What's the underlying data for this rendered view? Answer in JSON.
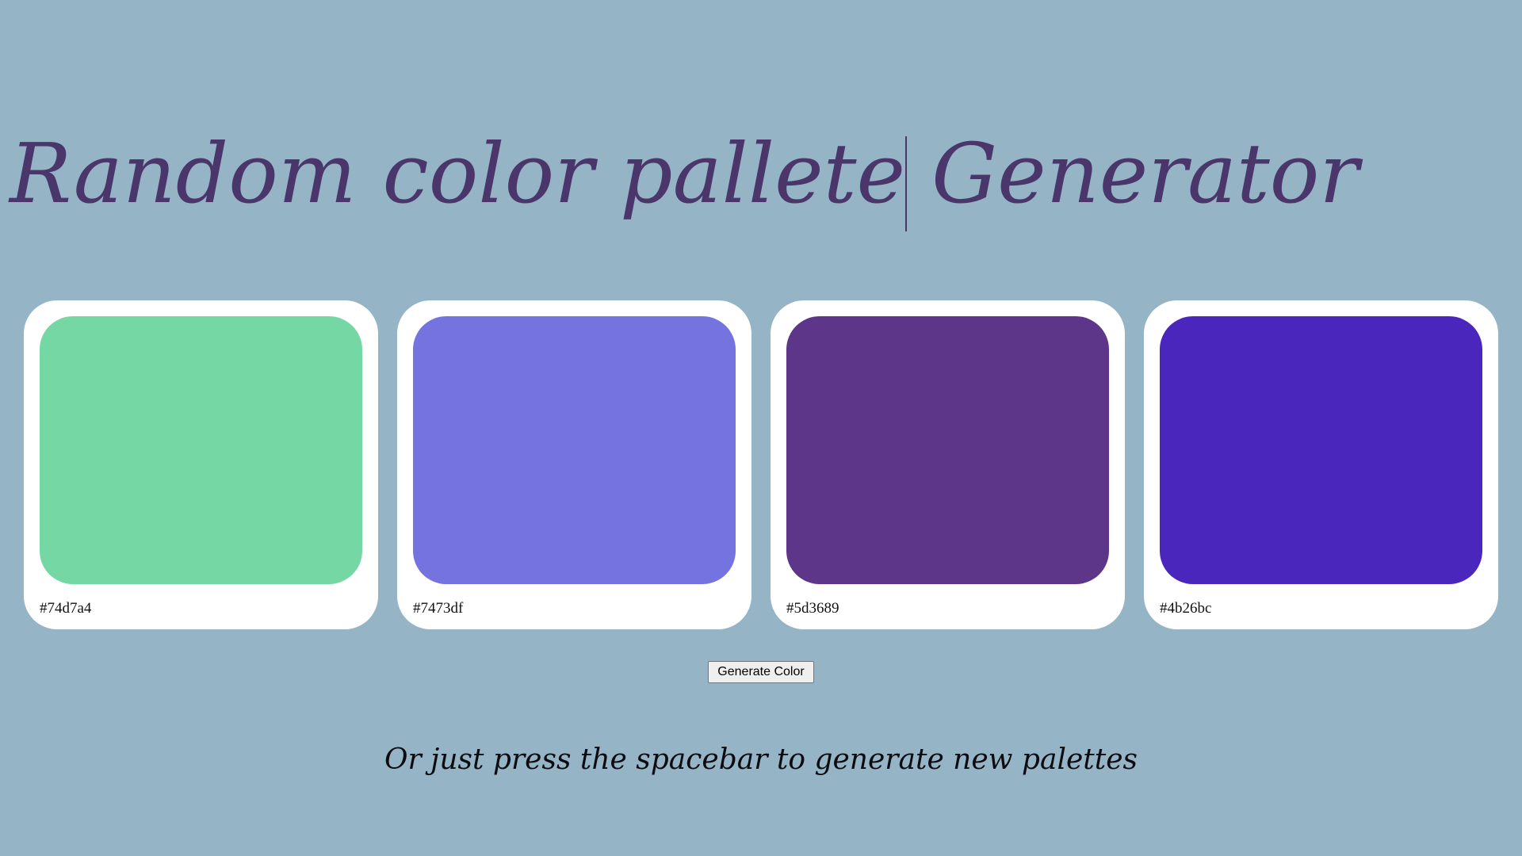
{
  "header": {
    "title": "Random color pallete Generator"
  },
  "palette": {
    "colors": [
      {
        "hex": "#74d7a4"
      },
      {
        "hex": "#7473df"
      },
      {
        "hex": "#5d3689"
      },
      {
        "hex": "#4b26bc"
      }
    ]
  },
  "controls": {
    "generate_label": "Generate Color"
  },
  "footer": {
    "hint": "Or just press the spacebar to generate new palettes"
  },
  "theme": {
    "background": "#95b4c6",
    "title_color": "#4a366a",
    "card_background": "#ffffff"
  }
}
